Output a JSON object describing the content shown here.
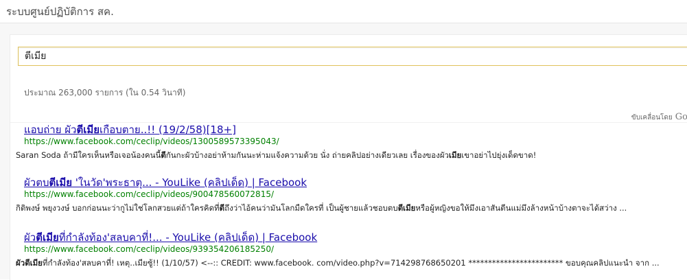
{
  "app": {
    "title": "ระบบศูนย์ปฏิบัติการ สค."
  },
  "search": {
    "query": "ตีเมีย",
    "stats": "ประมาณ 263,000 รายการ (ใน 0.54 วินาที)",
    "powered_by_label": "ขับเคลื่อนโดย",
    "powered_by_brand": "Go"
  },
  "results": [
    {
      "title_parts": [
        "แอบถ่าย ผัว",
        "ตีเมีย",
        "เกือบตาย..!! (19/2/58)[18+]"
      ],
      "url": "https://www.facebook.com/ceclip/videos/1300589573395043/",
      "snippet_parts": [
        "Saran Soda ถ้ามีใครเห็นหรือเจอน้องคนนี้",
        "ตี",
        "กันกะผัวบ้างอย่าห้ามกันนะห่ามแจ้งความด้วย นั่ง ถ่ายคลิปอย่างเดียวเลย เรื่องของผัว",
        "เมีย",
        "เขาอย่าไปยุ่งเด็ดขาด!"
      ]
    },
    {
      "title_parts": [
        "ผัวตบ",
        "ตีเมีย",
        " 'ในวัด'พระธาตุ... - YouLike (คลิปเด็ด) | Facebook"
      ],
      "url": "https://www.facebook.com/ceclip/videos/900478560072815/",
      "snippet_parts": [
        "กิติพงษ์ พยุงวงษ์ บอกก่อนนะว่ากูไม่ใช่โลกสวยแต่ถ้าใครคิดที่",
        "ตี",
        "ถึงว่าไอ้คนว่ามันโลกมืดใครที่ เป็นผู้ชายแล้วชอบตบ",
        "ตีเมีย",
        "หรือผู้หญิงขอให้มึงเอาสันตีนแม่มึงล้างหน้าบ้างตาจะได้สว่าง ..."
      ]
    },
    {
      "title_parts": [
        "ผัว",
        "ตีเมีย",
        "ที่กำลังท้อง'สลบคาที่!... - YouLike (คลิปเด็ด) | Facebook"
      ],
      "url": "https://www.facebook.com/ceclip/videos/939354206185250/",
      "snippet_parts": [
        "ผัว",
        "ตีเมีย",
        "ที่กำลังท้อง'สลบคาที่! เหตุ..เมียซู้!! (1/10/57) <--:: CREDIT: www.facebook. com/video.php?v=714298768650201 ************************ ขอบคุณคลิปแนะนำ จาก ..."
      ]
    }
  ]
}
